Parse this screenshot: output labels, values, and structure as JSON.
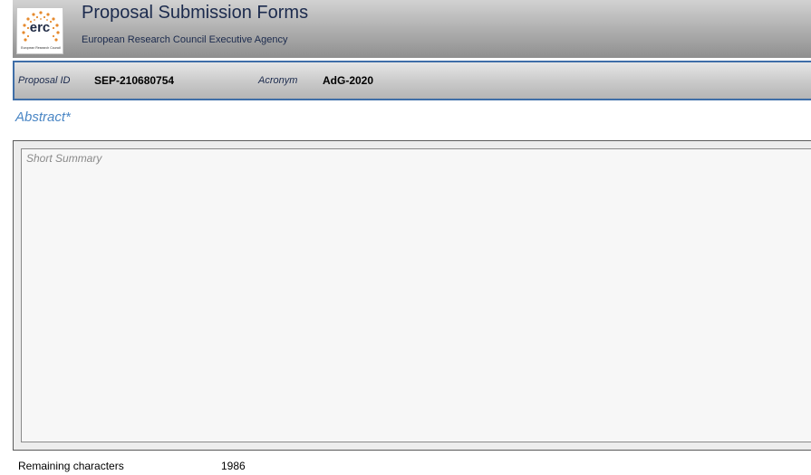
{
  "header": {
    "logo_text": "erc",
    "logo_small_text": "European Research Council",
    "title": "Proposal Submission Forms",
    "subtitle": "European Research Council Executive Agency"
  },
  "proposal": {
    "id_label": "Proposal ID",
    "id_value": "SEP-210680754",
    "acronym_label": "Acronym",
    "acronym_value": "AdG-2020"
  },
  "abstract": {
    "label": "Abstract*",
    "placeholder": "Short Summary",
    "value": ""
  },
  "footer": {
    "remaining_label": "Remaining characters",
    "remaining_value": "1986"
  },
  "colors": {
    "accent_blue": "#4a86c5",
    "border_blue": "#3f6ea8",
    "logo_orange": "#e58a2e"
  }
}
